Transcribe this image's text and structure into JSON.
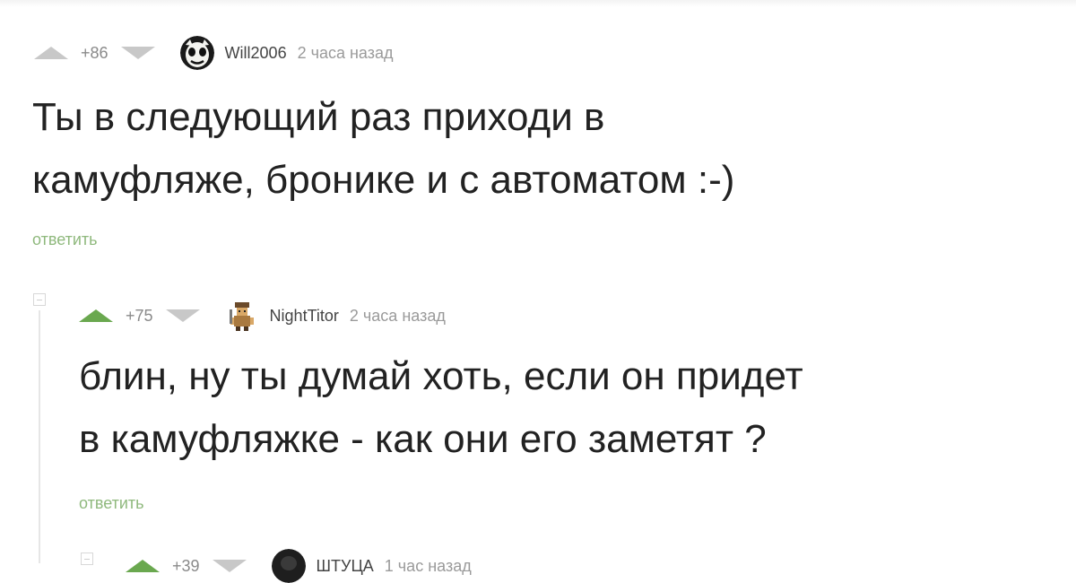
{
  "comments": [
    {
      "rating": "+86",
      "username": "Will2006",
      "time": "2 часа назад",
      "text_lines": [
        "Ты в следующий раз приходи в",
        "камуфляже, бронике и с автоматом :-)"
      ],
      "reply_label": "ответить",
      "upvote_active": false
    },
    {
      "rating": "+75",
      "username": "NightTitor",
      "time": "2 часа назад",
      "text_lines": [
        "блин, ну ты думай хоть, если он придет",
        "в камуфляжке - как они его заметят ?"
      ],
      "reply_label": "ответить",
      "upvote_active": true
    },
    {
      "rating": "+39",
      "username": "ШТУЦА",
      "time": "1 час назад"
    }
  ],
  "colors": {
    "upvote_active": "#6aa84f",
    "vote_inactive": "#c8c8c8",
    "reply_link": "#8fb97d",
    "meta_text": "#8a8a8a"
  },
  "icons": {
    "upvote": "triangle-up-icon",
    "downvote": "triangle-down-icon",
    "collapse": "collapse-box-icon"
  }
}
